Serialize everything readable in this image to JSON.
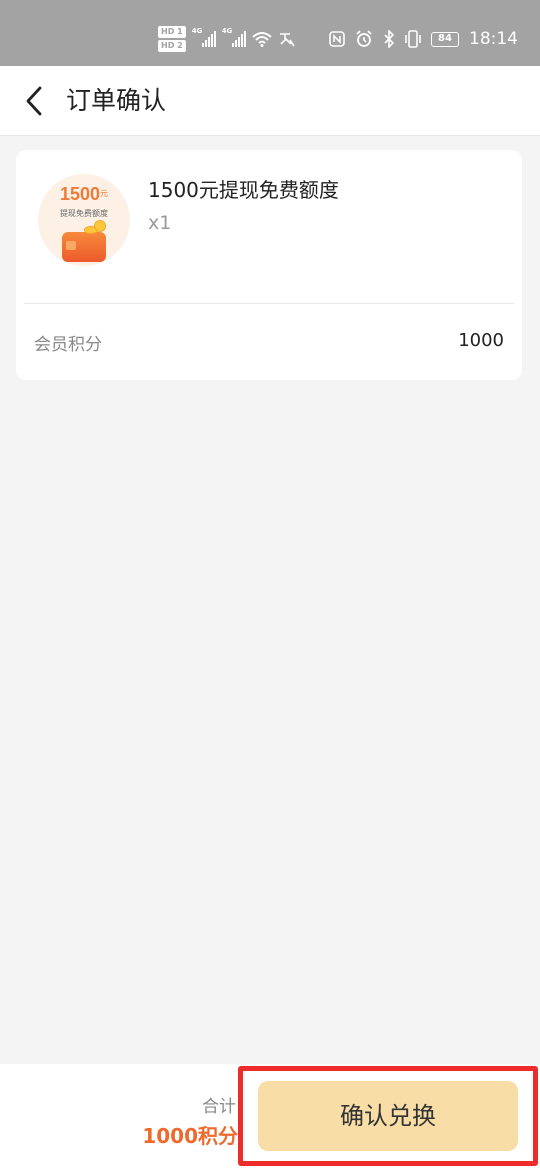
{
  "status_bar": {
    "hd_badge_1": "HD 1",
    "hd_badge_2": "HD 2",
    "network_1": "4G",
    "network_2": "4G",
    "battery": "84",
    "time": "18:14"
  },
  "header": {
    "title": "订单确认"
  },
  "product": {
    "thumb_amount": "1500",
    "thumb_unit": "元",
    "thumb_caption": "提现免费额度",
    "name": "1500元提现免费额度",
    "quantity": "x1"
  },
  "points": {
    "label": "会员积分",
    "value": "1000"
  },
  "footer": {
    "total_label": "合计",
    "total_value": "1000积分",
    "confirm_label": "确认兑换"
  },
  "colors": {
    "accent": "#ee6a2e",
    "button_bg": "#f8dda6",
    "highlight": "#ee2c2c",
    "status_bar": "#a3a3a3"
  },
  "icons": [
    "back-arrow-icon",
    "wifi-icon",
    "nfc-icon",
    "alarm-icon",
    "bluetooth-icon",
    "vibrate-icon",
    "battery-icon"
  ]
}
